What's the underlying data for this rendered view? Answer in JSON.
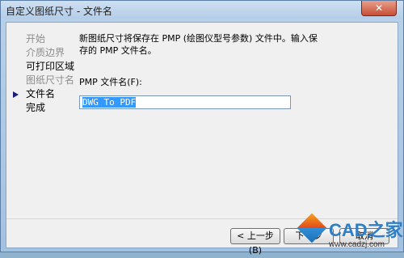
{
  "window": {
    "title": "自定义图纸尺寸 - 文件名",
    "close_glyph": "✕"
  },
  "sidebar": {
    "items": [
      {
        "label": "开始",
        "state": "disabled"
      },
      {
        "label": "介质边界",
        "state": "disabled"
      },
      {
        "label": "可打印区域",
        "state": "enabled"
      },
      {
        "label": "图纸尺寸名",
        "state": "disabled"
      },
      {
        "label": "文件名",
        "state": "current"
      },
      {
        "label": "完成",
        "state": "enabled"
      }
    ]
  },
  "main": {
    "description": "新图纸尺寸将保存在 PMP (绘图仪型号参数) 文件中。输入保存的 PMP 文件名。",
    "field_label": "PMP 文件名(F):",
    "field_value": "DWG To PDF"
  },
  "buttons": {
    "back": "< 上一步(B)",
    "next": "下一步",
    "cancel": "取消"
  },
  "watermark": {
    "brand": "CAD之家",
    "url": "www.cadzj.com"
  }
}
